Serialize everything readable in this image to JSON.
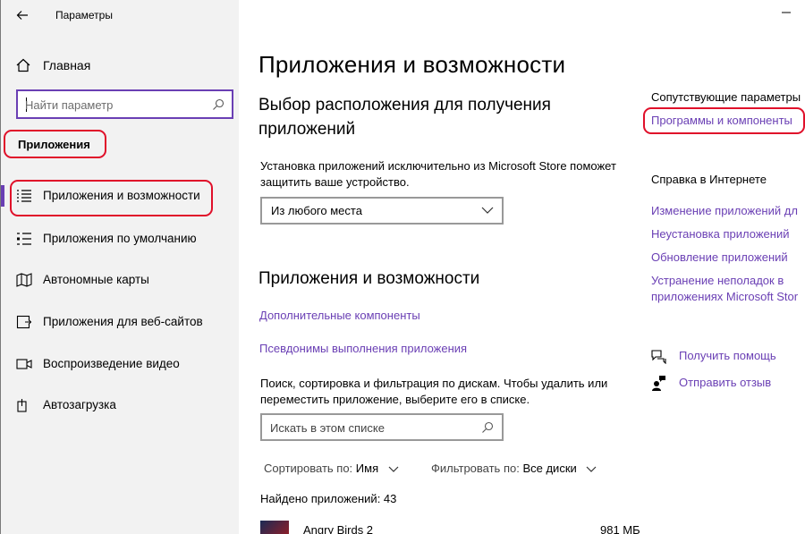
{
  "window": {
    "title": "Параметры"
  },
  "sidebar": {
    "home_label": "Главная",
    "search_placeholder": "Найти параметр",
    "section_label": "Приложения",
    "items": [
      {
        "label": "Приложения и возможности",
        "icon": "list-icon"
      },
      {
        "label": "Приложения по умолчанию",
        "icon": "default-apps-icon"
      },
      {
        "label": "Автономные карты",
        "icon": "map-icon"
      },
      {
        "label": "Приложения для веб-сайтов",
        "icon": "web-apps-icon"
      },
      {
        "label": "Воспроизведение видео",
        "icon": "video-icon"
      },
      {
        "label": "Автозагрузка",
        "icon": "startup-icon"
      }
    ]
  },
  "main": {
    "page_title": "Приложения и возможности",
    "install_section": {
      "heading": "Выбор расположения для получения приложений",
      "description": "Установка приложений исключительно из Microsoft Store поможет защитить ваше устройство.",
      "dropdown_value": "Из любого места"
    },
    "apps_section": {
      "heading": "Приложения и возможности",
      "link_optional": "Дополнительные компоненты",
      "link_aliases": "Псевдонимы выполнения приложения",
      "description": "Поиск, сортировка и фильтрация по дискам. Чтобы удалить или переместить приложение, выберите его в списке.",
      "search_placeholder": "Искать в этом списке",
      "sort_label": "Сортировать по:",
      "sort_value": "Имя",
      "filter_label": "Фильтровать по:",
      "filter_value": "Все диски",
      "found_count": "Найдено приложений: 43",
      "apps": [
        {
          "name": "Angry Birds 2",
          "size": "981 МБ"
        }
      ]
    }
  },
  "right_panel": {
    "related_title": "Сопутствующие параметры",
    "related_link": "Программы и компоненты",
    "web_help_title": "Справка в Интернете",
    "web_help_links": [
      "Изменение приложений дл",
      "Неустановка приложений",
      "Обновление приложений",
      "Устранение неполадок в",
      "приложениях Microsoft Stor"
    ],
    "get_help": "Получить помощь",
    "feedback": "Отправить отзыв"
  },
  "colors": {
    "accent": "#6a3fb4",
    "highlight_red": "#e0102a",
    "sidebar_bg": "#f2f2f2"
  }
}
